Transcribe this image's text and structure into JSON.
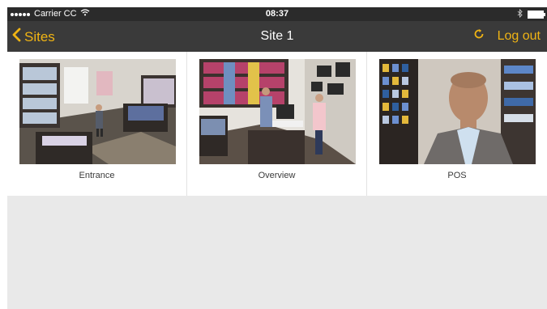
{
  "status": {
    "carrier": "Carrier CC",
    "time": "08:37"
  },
  "nav": {
    "back_label": "Sites",
    "title": "Site 1",
    "logout_label": "Log out"
  },
  "colors": {
    "accent": "#f0b414",
    "nav_bg": "#3a3a3a",
    "status_bg": "#2b2b2b",
    "content_bg": "#e9e9e9"
  },
  "icons": {
    "back": "chevron-left-icon",
    "refresh": "refresh-icon",
    "wifi": "wifi-icon",
    "bluetooth": "bluetooth-icon",
    "battery": "battery-icon"
  },
  "cameras": [
    {
      "label": "Entrance"
    },
    {
      "label": "Overview"
    },
    {
      "label": "POS"
    }
  ]
}
